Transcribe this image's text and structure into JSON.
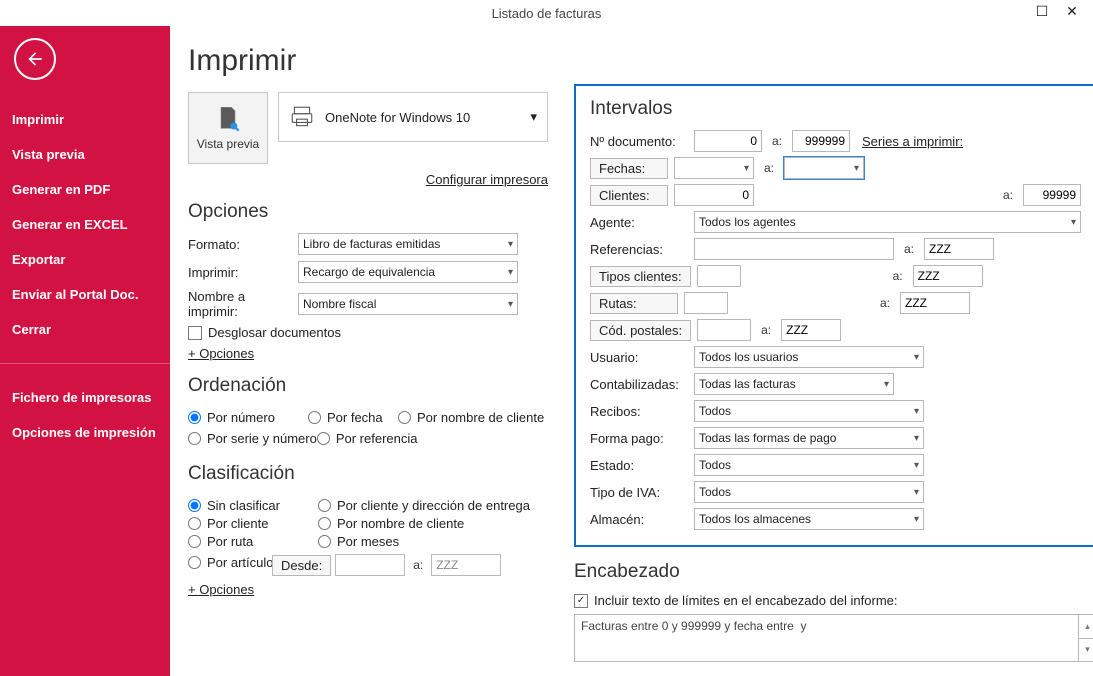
{
  "window": {
    "title": "Listado de facturas"
  },
  "sidebar": {
    "items": [
      "Imprimir",
      "Vista previa",
      "Generar en PDF",
      "Generar en EXCEL",
      "Exportar",
      "Enviar al Portal Doc.",
      "Cerrar"
    ],
    "items2": [
      "Fichero de impresoras",
      "Opciones de impresión"
    ]
  },
  "page": {
    "title": "Imprimir",
    "preview_label": "Vista previa",
    "printer_name": "OneNote for Windows 10",
    "configure_printer": "Configurar impresora"
  },
  "opciones": {
    "heading": "Opciones",
    "formato_label": "Formato:",
    "formato_value": "Libro de facturas emitidas",
    "imprimir_label": "Imprimir:",
    "imprimir_value": "Recargo de equivalencia",
    "nombre_label": "Nombre a imprimir:",
    "nombre_value": "Nombre fiscal",
    "desglosar": "Desglosar documentos",
    "more": "+ Opciones"
  },
  "ordenacion": {
    "heading": "Ordenación",
    "opts": [
      "Por número",
      "Por fecha",
      "Por nombre de cliente",
      "Por serie y número",
      "Por referencia"
    ],
    "selected": 0
  },
  "clasificacion": {
    "heading": "Clasificación",
    "opts": [
      "Sin clasificar",
      "Por cliente y dirección de entrega",
      "Por cliente",
      "Por nombre de cliente",
      "Por ruta",
      "Por meses",
      "Por artículo"
    ],
    "selected": 0,
    "desde_label": "Desde:",
    "desde_value": "",
    "a_label": "a:",
    "a_value": "ZZZ",
    "more": "+ Opciones"
  },
  "intervalos": {
    "heading": "Intervalos",
    "ndoc_label": "Nº documento:",
    "ndoc_from": "0",
    "ndoc_to": "999999",
    "series_link": "Series a imprimir:",
    "fechas_label": "Fechas:",
    "fechas_from": "",
    "fechas_to": "",
    "clientes_label": "Clientes:",
    "clientes_from": "0",
    "clientes_to": "99999",
    "agente_label": "Agente:",
    "agente_value": "Todos los agentes",
    "ref_label": "Referencias:",
    "ref_from": "",
    "ref_to": "ZZZ",
    "tipos_label": "Tipos clientes:",
    "tipos_from": "",
    "tipos_to": "ZZZ",
    "rutas_label": "Rutas:",
    "rutas_from": "",
    "rutas_to": "ZZZ",
    "cp_label": "Cód. postales:",
    "cp_from": "",
    "cp_to": "ZZZ",
    "usuario_label": "Usuario:",
    "usuario_value": "Todos los usuarios",
    "contab_label": "Contabilizadas:",
    "contab_value": "Todas las facturas",
    "recibos_label": "Recibos:",
    "recibos_value": "Todos",
    "fpago_label": "Forma pago:",
    "fpago_value": "Todas las formas de pago",
    "estado_label": "Estado:",
    "estado_value": "Todos",
    "iva_label": "Tipo de IVA:",
    "iva_value": "Todos",
    "almacen_label": "Almacén:",
    "almacen_value": "Todos los almacenes",
    "a": "a:"
  },
  "encabezado": {
    "heading": "Encabezado",
    "check_label": "Incluir texto de límites en el encabezado del informe:",
    "text": "Facturas entre 0 y 999999 y fecha entre  y"
  }
}
